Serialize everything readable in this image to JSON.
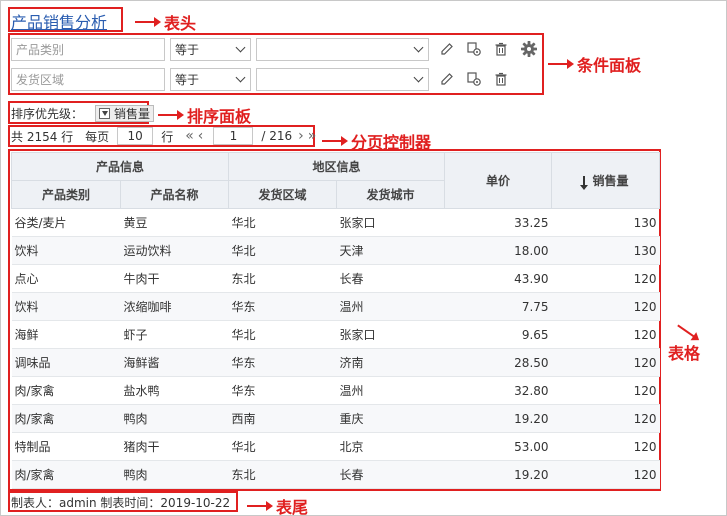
{
  "title": "产品销售分析",
  "callouts": {
    "header": "表头",
    "condition": "条件面板",
    "sort": "排序面板",
    "pager": "分页控制器",
    "table": "表格",
    "footer": "表尾"
  },
  "conditions": [
    {
      "field_placeholder": "产品类别",
      "operator": "等于",
      "value": ""
    },
    {
      "field_placeholder": "发货区域",
      "operator": "等于",
      "value": ""
    }
  ],
  "icons": [
    "pencil-icon",
    "copy-gear-icon",
    "trash-icon",
    "gear-icon"
  ],
  "sort": {
    "label": "排序优先级：",
    "button_label": "销售量"
  },
  "pager": {
    "total": "共 2154 行",
    "per_page_label": "每页",
    "per_page": "10",
    "row_unit": "行",
    "page": "1",
    "total_pages": "/ 216"
  },
  "table": {
    "group_headers": [
      "产品信息",
      "地区信息"
    ],
    "headers": [
      "产品类别",
      "产品名称",
      "发货区域",
      "发货城市",
      "单价",
      "销售量"
    ],
    "rows": [
      [
        "谷类/麦片",
        "黄豆",
        "华北",
        "张家口",
        "33.25",
        "130"
      ],
      [
        "饮料",
        "运动饮料",
        "华北",
        "天津",
        "18.00",
        "130"
      ],
      [
        "点心",
        "牛肉干",
        "东北",
        "长春",
        "43.90",
        "120"
      ],
      [
        "饮料",
        "浓缩咖啡",
        "华东",
        "温州",
        "7.75",
        "120"
      ],
      [
        "海鲜",
        "虾子",
        "华北",
        "张家口",
        "9.65",
        "120"
      ],
      [
        "调味品",
        "海鲜酱",
        "华东",
        "济南",
        "28.50",
        "120"
      ],
      [
        "肉/家禽",
        "盐水鸭",
        "华东",
        "温州",
        "32.80",
        "120"
      ],
      [
        "肉/家禽",
        "鸭肉",
        "西南",
        "重庆",
        "19.20",
        "120"
      ],
      [
        "特制品",
        "猪肉干",
        "华北",
        "北京",
        "53.00",
        "120"
      ],
      [
        "肉/家禽",
        "鸭肉",
        "东北",
        "长春",
        "19.20",
        "120"
      ]
    ]
  },
  "footer": "制表人：admin 制表时间：2019-10-22",
  "colors": {
    "accent": "#e02020",
    "link": "#2a5db0",
    "header_bg": "#eef1f5"
  }
}
